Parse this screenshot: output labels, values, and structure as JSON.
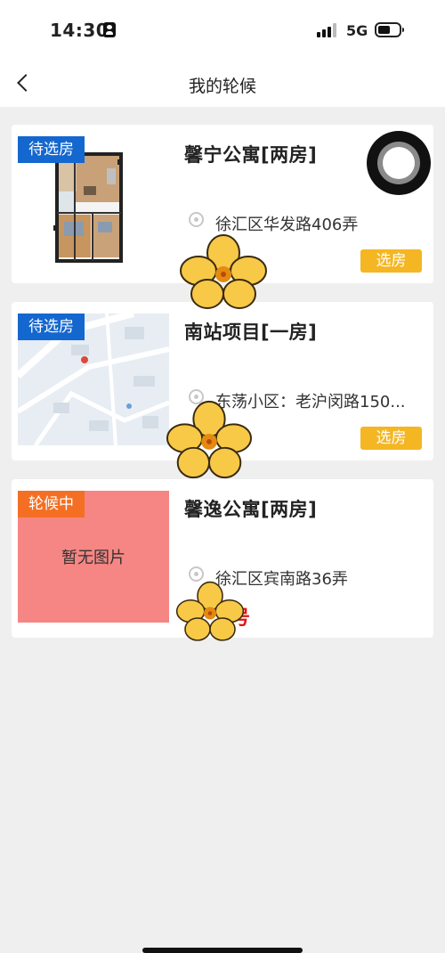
{
  "status_bar": {
    "time": "14:30",
    "network": "5G",
    "icons": [
      "id-card-icon",
      "signal-bars-icon",
      "battery-icon"
    ]
  },
  "nav": {
    "title": "我的轮候",
    "back_icon": "chevron-left-icon"
  },
  "listings": [
    {
      "badge": "待选房",
      "badge_color": "#1467cf",
      "thumbnail": "floor-plan",
      "title": "馨宁公寓[两房]",
      "address": "徐汇区华发路406弄",
      "action": "选房"
    },
    {
      "badge": "待选房",
      "badge_color": "#1467cf",
      "thumbnail": "map",
      "title": "南站项目[一房]",
      "address": "东荡小区：老沪闵路150...",
      "action": "选房"
    },
    {
      "badge": "轮候中",
      "badge_color": "#f46f24",
      "thumbnail_text": "暂无图片",
      "title": "馨逸公寓[两房]",
      "address": "徐汇区宾南路36弄",
      "queue_suffix": "号"
    }
  ],
  "colors": {
    "accent_blue": "#1467cf",
    "accent_orange": "#f46f24",
    "select_button": "#f5b623",
    "placeholder_bg": "#f58683"
  },
  "decorations": [
    "flower-sticker",
    "flower-sticker",
    "flower-sticker",
    "record-disc-icon"
  ]
}
